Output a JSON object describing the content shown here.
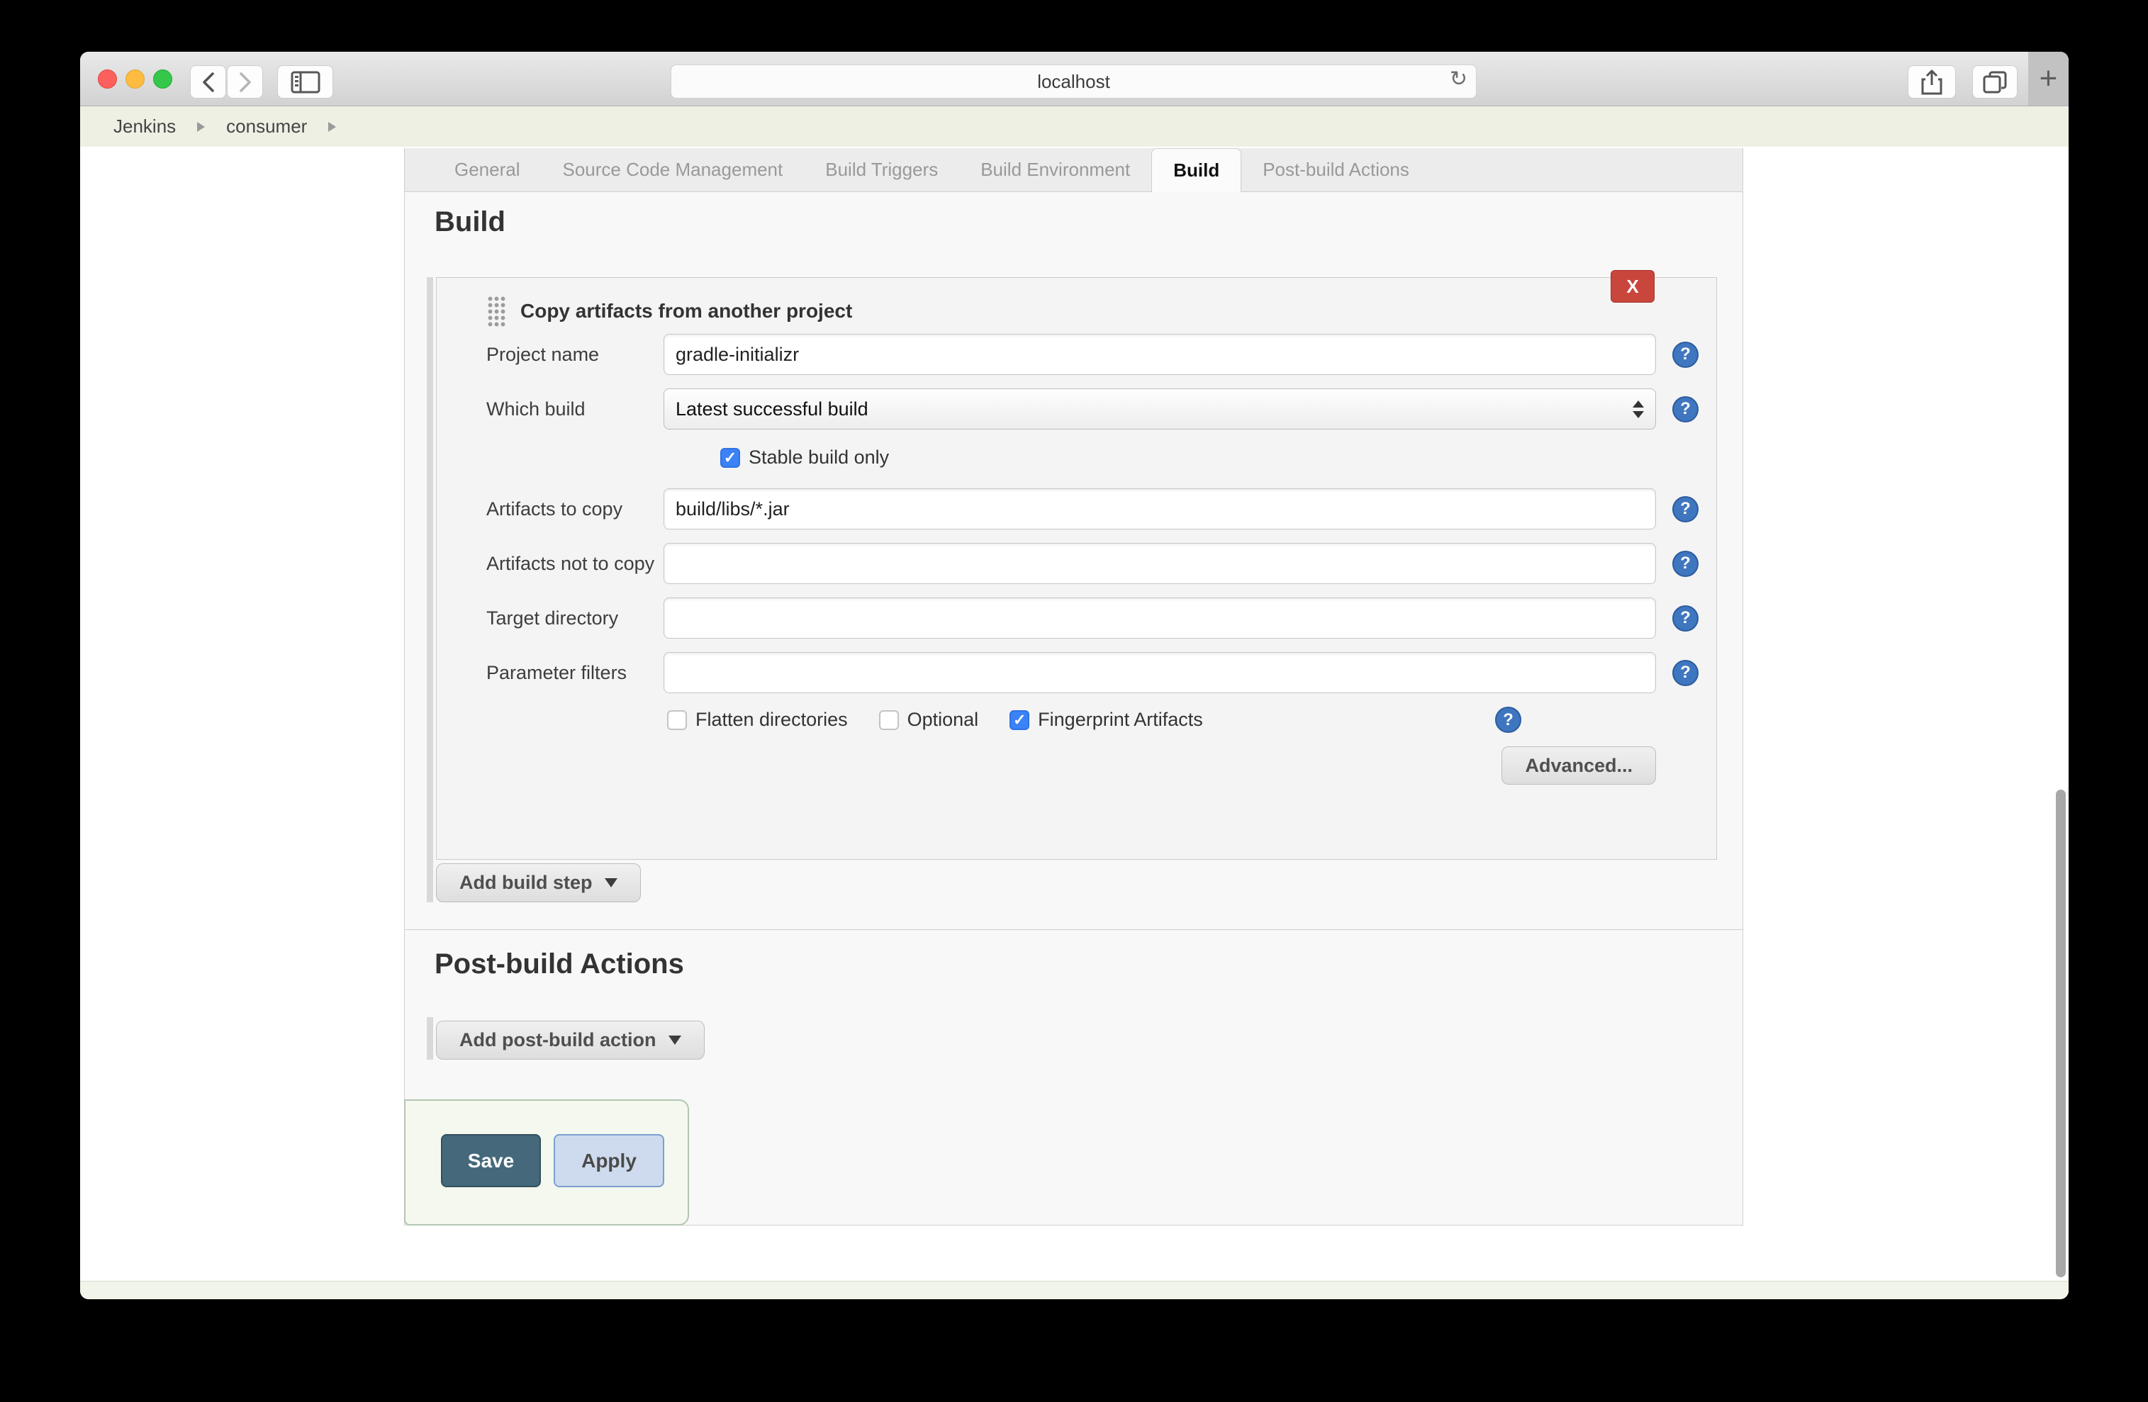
{
  "browser": {
    "url": "localhost",
    "new_tab_label": "+",
    "icons": {
      "back": "chevron-left",
      "forward": "chevron-right",
      "sidebar": "sidebar-panel",
      "reload": "reload-arrow",
      "share": "share-box-arrow",
      "tab_overview": "overlapping-squares"
    }
  },
  "breadcrumb": {
    "items": [
      "Jenkins",
      "consumer"
    ]
  },
  "tabs": [
    {
      "label": "General",
      "active": false
    },
    {
      "label": "Source Code Management",
      "active": false
    },
    {
      "label": "Build Triggers",
      "active": false
    },
    {
      "label": "Build Environment",
      "active": false
    },
    {
      "label": "Build",
      "active": true
    },
    {
      "label": "Post-build Actions",
      "active": false
    }
  ],
  "build_section": {
    "heading": "Build",
    "step": {
      "title": "Copy artifacts from another project",
      "delete_label": "X",
      "help_glyph": "?",
      "fields": {
        "project_name": {
          "label": "Project name",
          "value": "gradle-initializr"
        },
        "which_build": {
          "label": "Which build",
          "value": "Latest successful build"
        },
        "stable_build_only": {
          "label": "Stable build only",
          "checked": true
        },
        "artifacts_to_copy": {
          "label": "Artifacts to copy",
          "value": "build/libs/*.jar"
        },
        "artifacts_not_to_copy": {
          "label": "Artifacts not to copy",
          "value": ""
        },
        "target_directory": {
          "label": "Target directory",
          "value": ""
        },
        "parameter_filters": {
          "label": "Parameter filters",
          "value": ""
        },
        "flatten_directories": {
          "label": "Flatten directories",
          "checked": false
        },
        "optional": {
          "label": "Optional",
          "checked": false
        },
        "fingerprint_artifacts": {
          "label": "Fingerprint Artifacts",
          "checked": true
        }
      },
      "advanced_label": "Advanced..."
    },
    "add_build_step_label": "Add build step"
  },
  "post_build_section": {
    "heading": "Post-build Actions",
    "add_action_label": "Add post-build action"
  },
  "actions": {
    "save_label": "Save",
    "apply_label": "Apply"
  },
  "colors": {
    "delete_button": "#c9463d",
    "save_button": "#45687b",
    "apply_button": "#cedbee",
    "checkbox_checked": "#3b82f7",
    "help_icon": "#3f76c0",
    "breadcrumb_bg": "#eef0e4",
    "panel_bg": "#f8f8f8"
  }
}
